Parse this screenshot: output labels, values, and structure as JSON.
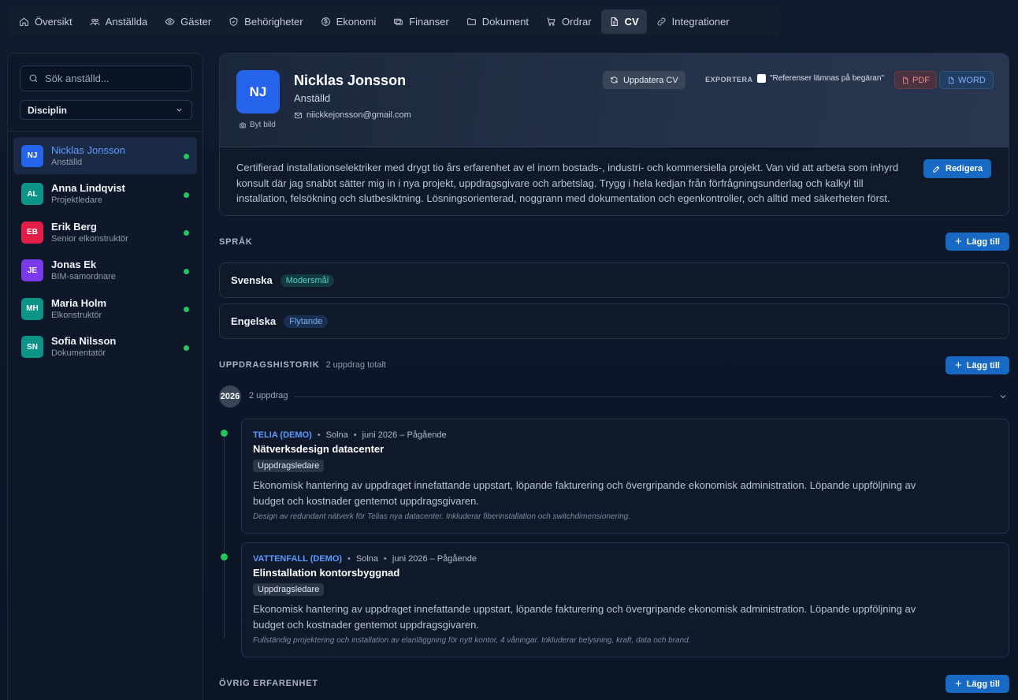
{
  "nav": {
    "items": [
      {
        "label": "Översikt",
        "icon": "home-icon"
      },
      {
        "label": "Anställda",
        "icon": "users-icon"
      },
      {
        "label": "Gäster",
        "icon": "eye-icon"
      },
      {
        "label": "Behörigheter",
        "icon": "shield-icon"
      },
      {
        "label": "Ekonomi",
        "icon": "dollar-icon"
      },
      {
        "label": "Finanser",
        "icon": "finance-icon"
      },
      {
        "label": "Dokument",
        "icon": "folder-icon"
      },
      {
        "label": "Ordrar",
        "icon": "cart-icon"
      },
      {
        "label": "CV",
        "icon": "document-icon"
      },
      {
        "label": "Integrationer",
        "icon": "link-icon"
      }
    ],
    "active": "CV"
  },
  "sidebar": {
    "search_placeholder": "Sök anställd...",
    "filter_label": "Disciplin",
    "employees": [
      {
        "initials": "NJ",
        "name": "Nicklas Jonsson",
        "role": "Anställd",
        "color": "#2563eb",
        "active": true
      },
      {
        "initials": "AL",
        "name": "Anna Lindqvist",
        "role": "Projektledare",
        "color": "#0d9488",
        "active": false
      },
      {
        "initials": "EB",
        "name": "Erik Berg",
        "role": "Senior elkonstruktör",
        "color": "#e11d48",
        "active": false
      },
      {
        "initials": "JE",
        "name": "Jonas Ek",
        "role": "BIM-samordnare",
        "color": "#7c3aed",
        "active": false
      },
      {
        "initials": "MH",
        "name": "Maria Holm",
        "role": "Elkonstruktör",
        "color": "#0d9488",
        "active": false
      },
      {
        "initials": "SN",
        "name": "Sofia Nilsson",
        "role": "Dokumentatör",
        "color": "#0d9488",
        "active": false
      }
    ]
  },
  "profile": {
    "initials": "NJ",
    "change_photo": "Byt bild",
    "name": "Nicklas Jonsson",
    "role": "Anställd",
    "email": "niickkejonsson@gmail.com",
    "update_cv": "Uppdatera CV",
    "export_label": "EXPORTERA",
    "references_checkbox": "\"Referenser lämnas på begäran\"",
    "pdf": "PDF",
    "word": "WORD",
    "summary": "Certifierad installationselektriker med drygt tio års erfarenhet av el inom bostads-, industri- och kommersiella projekt. Van vid att arbeta som inhyrd konsult där jag snabbt sätter mig in i nya projekt, uppdragsgivare och arbetslag. Trygg i hela kedjan från förfrågningsunderlag och kalkyl till installation, felsökning och slutbesiktning. Lösningsorienterad, noggrann med dokumentation och egenkontroller, och alltid med säkerheten först.",
    "edit": "Redigera"
  },
  "languages": {
    "title": "SPRÅK",
    "add": "Lägg till",
    "items": [
      {
        "name": "Svenska",
        "level": "Modersmål"
      },
      {
        "name": "Engelska",
        "level": "Flytande"
      }
    ]
  },
  "assignments": {
    "title": "UPPDRAGSHISTORIK",
    "subtitle": "2 uppdrag totalt",
    "add": "Lägg till",
    "year": "2026",
    "year_count": "2 uppdrag",
    "items": [
      {
        "company": "TELIA (DEMO)",
        "location": "Solna",
        "period": "juni 2026 – Pågående",
        "title": "Nätverksdesign datacenter",
        "role": "Uppdragsledare",
        "description": "Ekonomisk hantering av uppdraget innefattande uppstart, löpande fakturering och övergripande ekonomisk administration. Löpande uppföljning av budget och kostnader gentemot uppdragsgivaren.",
        "note": "Design av redundant nätverk för Telias nya datacenter. Inkluderar fiberinstallation och switchdimensionering."
      },
      {
        "company": "VATTENFALL (DEMO)",
        "location": "Solna",
        "period": "juni 2026 – Pågående",
        "title": "Elinstallation kontorsbyggnad",
        "role": "Uppdragsledare",
        "description": "Ekonomisk hantering av uppdraget innefattande uppstart, löpande fakturering och övergripande ekonomisk administration. Löpande uppföljning av budget och kostnader gentemot uppdragsgivaren.",
        "note": "Fullständig projektering och installation av elanläggning för nytt kontor, 4 våningar. Inkluderar belysning, kraft, data och brand."
      }
    ]
  },
  "other_experience": {
    "title": "ÖVRIG ERFARENHET",
    "add": "Lägg till"
  }
}
